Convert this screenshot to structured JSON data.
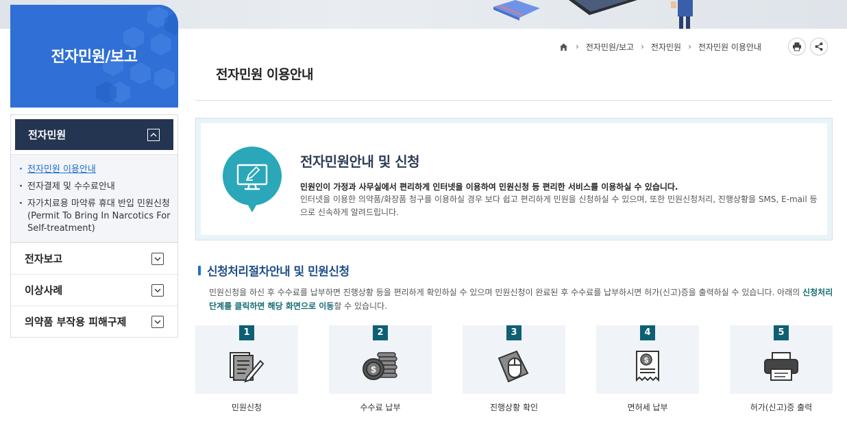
{
  "sidebar": {
    "title": "전자민원/보고",
    "active_section": "전자민원",
    "sub_items": [
      {
        "label": "전자민원 이용안내",
        "current": true
      },
      {
        "label": "전자결제 및 수수료안내",
        "current": false
      },
      {
        "label": "자가치료용 마약류 휴대 반입 민원신청(Permit To Bring In Narcotics For Self-treatment)",
        "current": false
      }
    ],
    "sections": [
      {
        "label": "전자보고"
      },
      {
        "label": "이상사례"
      },
      {
        "label": "의약품 부작용 피해구제"
      }
    ]
  },
  "breadcrumb": {
    "home_icon": "home-icon",
    "items": [
      "전자민원/보고",
      "전자민원",
      "전자민원 이용안내"
    ]
  },
  "toolbar": {
    "print_icon": "print-icon",
    "share_icon": "share-icon"
  },
  "page": {
    "title": "전자민원 이용안내"
  },
  "intro": {
    "icon": "monitor-pen-icon",
    "title": "전자민원안내 및 신청",
    "strong": "민원인이 가정과 사무실에서 편리하게 인터넷을 이용하여 민원신청 등 편리한 서비스를 이용하실 수 있습니다.",
    "desc": "인터넷을 이용한 의약품/화장품 청구를 이용하실 경우 보다 쉽고 편리하게 민원을 신청하실 수 있으며, 또한 민원신청처리, 진행상황을 SMS, E-mail 등으로 신속하게 알려드립니다."
  },
  "process": {
    "title": "신청처리절차안내 및 민원신청",
    "desc_part1": "민원신청을 하신 후 수수료를 납부하면 진행상황 등을 편리하게 확인하실 수 있으며 민원신청이 완료된 후 수수료를 납부하시면 허가(신고)증을 출력하실 수 있습니다. 아래의 ",
    "desc_highlight": "신청처리 단계를 클릭하면 해당 화면으로 이동",
    "desc_part2": "할 수 있습니다.",
    "steps": [
      {
        "num": "1",
        "label": "민원신청",
        "icon": "document-pen-icon"
      },
      {
        "num": "2",
        "label": "수수료 납부",
        "icon": "coins-icon"
      },
      {
        "num": "3",
        "label": "진행상황 확인",
        "icon": "mouse-icon"
      },
      {
        "num": "4",
        "label": "면허세 납부",
        "icon": "receipt-icon"
      },
      {
        "num": "5",
        "label": "허가(신고)증 출력",
        "icon": "printer-icon"
      }
    ]
  },
  "colors": {
    "sidebar_blue": "#2f6fd6",
    "nav_dark": "#243552",
    "accent_blue": "#1f6fd1",
    "step_badge": "#0f5f74",
    "highlight_teal": "#136b74"
  }
}
